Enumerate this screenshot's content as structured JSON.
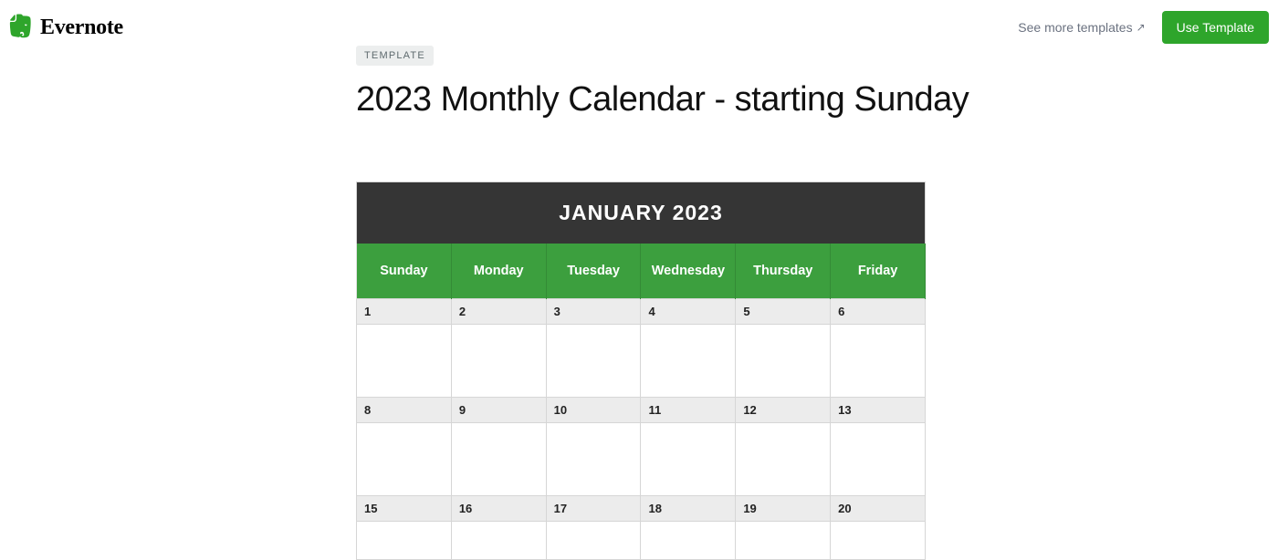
{
  "header": {
    "brand": "Evernote",
    "see_more": "See more templates",
    "see_more_arrow": "↗",
    "use_template": "Use Template"
  },
  "page": {
    "badge": "TEMPLATE",
    "title": "2023 Monthly Calendar - starting Sunday"
  },
  "calendar": {
    "month_title": "JANUARY 2023",
    "day_headers": [
      "Sunday",
      "Monday",
      "Tuesday",
      "Wednesday",
      "Thursday",
      "Friday"
    ],
    "rows": [
      [
        "1",
        "2",
        "3",
        "4",
        "5",
        "6"
      ],
      [
        "8",
        "9",
        "10",
        "11",
        "12",
        "13"
      ],
      [
        "15",
        "16",
        "17",
        "18",
        "19",
        "20"
      ]
    ]
  }
}
